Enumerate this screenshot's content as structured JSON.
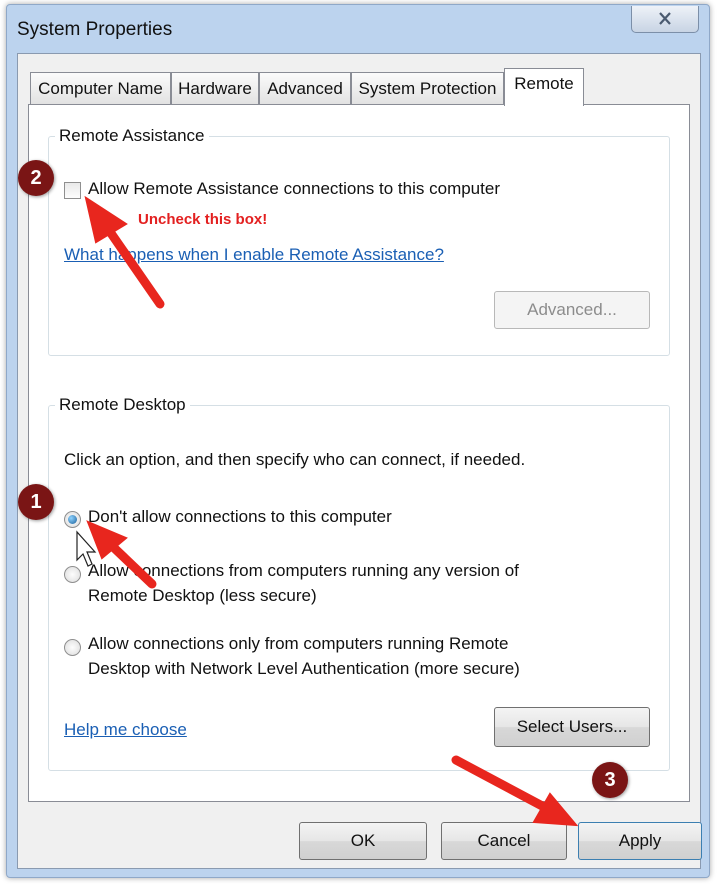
{
  "window": {
    "title": "System Properties"
  },
  "tabs": [
    {
      "label": "Computer Name"
    },
    {
      "label": "Hardware"
    },
    {
      "label": "Advanced"
    },
    {
      "label": "System Protection"
    },
    {
      "label": "Remote"
    }
  ],
  "remote_assistance": {
    "group_title": "Remote Assistance",
    "checkbox_label": "Allow Remote Assistance connections to this computer",
    "checkbox_checked": false,
    "help_link": "What happens when I enable Remote Assistance?",
    "advanced_button": "Advanced..."
  },
  "remote_desktop": {
    "group_title": "Remote Desktop",
    "instructions": "Click an option, and then specify who can connect, if needed.",
    "options": [
      {
        "line1": "Don't allow connections to this computer",
        "line2": "",
        "selected": true
      },
      {
        "line1": "Allow connections from computers running any version of",
        "line2": "Remote Desktop (less secure)",
        "selected": false
      },
      {
        "line1": "Allow connections only from computers running Remote",
        "line2": "Desktop with Network Level Authentication (more secure)",
        "selected": false
      }
    ],
    "help_link": "Help me choose",
    "select_users_button": "Select Users..."
  },
  "footer": {
    "ok": "OK",
    "cancel": "Cancel",
    "apply": "Apply"
  },
  "annotations": {
    "badge_1": "1",
    "badge_2": "2",
    "badge_3": "3",
    "note": "Uncheck this box!",
    "arrow_color": "#e8261e",
    "badge_color": "#7a1515"
  }
}
